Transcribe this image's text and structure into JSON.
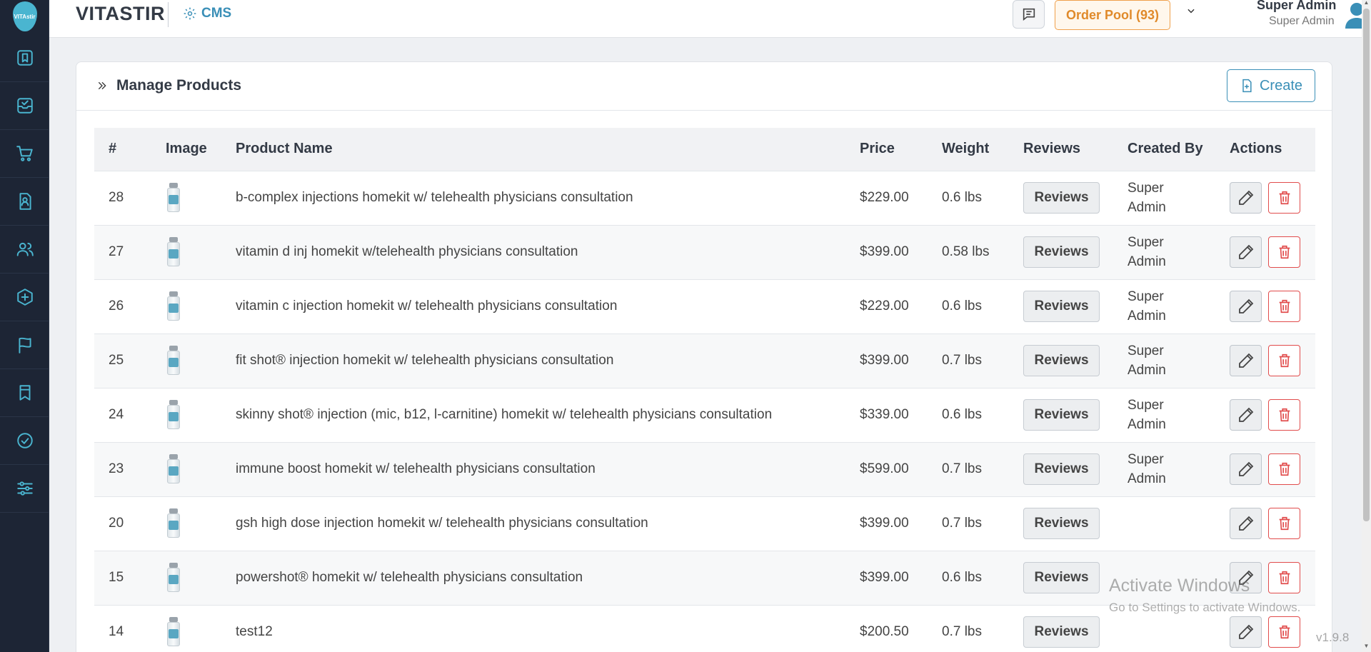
{
  "brand": {
    "name": "VITASTIR",
    "logo_text": "VITAstir",
    "section_label": "CMS"
  },
  "sidebar": {
    "items": [
      {
        "icon": "bookmark-icon"
      },
      {
        "icon": "inbox-check-icon"
      },
      {
        "icon": "cart-icon"
      },
      {
        "icon": "doctor-file-icon"
      },
      {
        "icon": "users-icon"
      },
      {
        "icon": "medical-bag-icon"
      },
      {
        "icon": "flag-icon"
      },
      {
        "icon": "bookmark-outline-icon"
      },
      {
        "icon": "check-circle-icon"
      },
      {
        "icon": "sliders-icon"
      }
    ]
  },
  "header": {
    "order_pool": "Order Pool (93)",
    "user_name": "Super Admin",
    "user_role": "Super Admin"
  },
  "page": {
    "title": "Manage Products",
    "create_label": "Create"
  },
  "table": {
    "headers": {
      "num": "#",
      "image": "Image",
      "name": "Product Name",
      "price": "Price",
      "weight": "Weight",
      "reviews": "Reviews",
      "created_by": "Created By",
      "actions": "Actions"
    },
    "rows": [
      {
        "id": "28",
        "name": "b-complex injections homekit w/ telehealth physicians consultation",
        "price": "$229.00",
        "weight": "0.6 lbs",
        "reviews_label": "Reviews",
        "created_by": "Super Admin"
      },
      {
        "id": "27",
        "name": "vitamin d inj homekit w/telehealth physicians consultation",
        "price": "$399.00",
        "weight": "0.58 lbs",
        "reviews_label": "Reviews",
        "created_by": "Super Admin"
      },
      {
        "id": "26",
        "name": "vitamin c injection homekit w/ telehealth physicians consultation",
        "price": "$229.00",
        "weight": "0.6 lbs",
        "reviews_label": "Reviews",
        "created_by": "Super Admin"
      },
      {
        "id": "25",
        "name": "fit shot® injection homekit w/ telehealth physicians consultation",
        "price": "$399.00",
        "weight": "0.7 lbs",
        "reviews_label": "Reviews",
        "created_by": "Super Admin"
      },
      {
        "id": "24",
        "name": "skinny shot® injection (mic, b12, l-carnitine) homekit w/ telehealth physicians consultation",
        "price": "$339.00",
        "weight": "0.6 lbs",
        "reviews_label": "Reviews",
        "created_by": "Super Admin"
      },
      {
        "id": "23",
        "name": "immune boost homekit w/ telehealth physicians consultation",
        "price": "$599.00",
        "weight": "0.7 lbs",
        "reviews_label": "Reviews",
        "created_by": "Super Admin"
      },
      {
        "id": "20",
        "name": "gsh high dose injection homekit w/ telehealth physicians consultation",
        "price": "$399.00",
        "weight": "0.7 lbs",
        "reviews_label": "Reviews",
        "created_by": ""
      },
      {
        "id": "15",
        "name": "powershot® homekit w/ telehealth physicians consultation",
        "price": "$399.00",
        "weight": "0.6 lbs",
        "reviews_label": "Reviews",
        "created_by": ""
      },
      {
        "id": "14",
        "name": "test12",
        "price": "$200.50",
        "weight": "0.7 lbs",
        "reviews_label": "Reviews",
        "created_by": ""
      }
    ]
  },
  "watermark": {
    "title": "Activate Windows",
    "subtitle": "Go to Settings to activate Windows."
  },
  "version": "v1.9.8",
  "colors": {
    "sidebar_bg": "#1d2535",
    "accent": "#3a8fb7",
    "order_pool": "#e08a2a",
    "danger": "#e14c4c"
  }
}
